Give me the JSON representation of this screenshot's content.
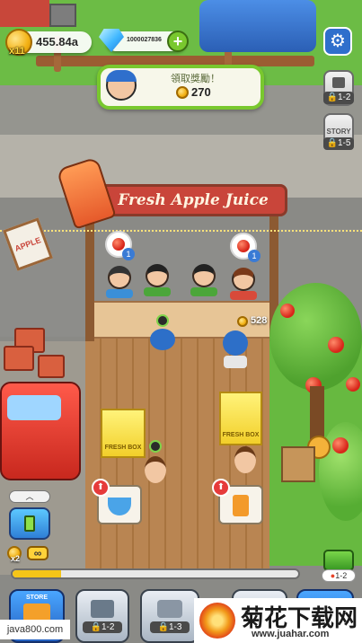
{
  "hud": {
    "cash_value": "455.84a",
    "cash_multiplier": "x11",
    "gems_value": "1000027836",
    "add_gems_label": "+"
  },
  "reward_popup": {
    "title": "領取獎勵！",
    "amount": "270"
  },
  "side_buttons": [
    {
      "name": "locked-level-1-2",
      "label": "1-2"
    },
    {
      "name": "story",
      "label": "STORY",
      "sub_label": "1-5"
    }
  ],
  "stand": {
    "sign_text": "Fresh Apple Juice",
    "left_sign_text": "APPLE",
    "tip_amount": "528",
    "box_label": "FRESH BOX",
    "order_badges": [
      "1",
      "1"
    ]
  },
  "bottom_hud": {
    "boost_multiplier": "x2",
    "infinity_symbol": "∞",
    "progress_fraction": 0.17,
    "map_level_label": "1-2",
    "store_label": "STORE",
    "nav_items": [
      {
        "label": "1-2"
      },
      {
        "label": "1-3"
      }
    ]
  },
  "watermarks": {
    "left": "java800.com",
    "brand_cn": "菊花下载网",
    "brand_url": "www.juahar.com"
  },
  "colors": {
    "accent_green": "#79c82e",
    "sign_red": "#c9453a",
    "progress_yellow": "#f5c518"
  }
}
